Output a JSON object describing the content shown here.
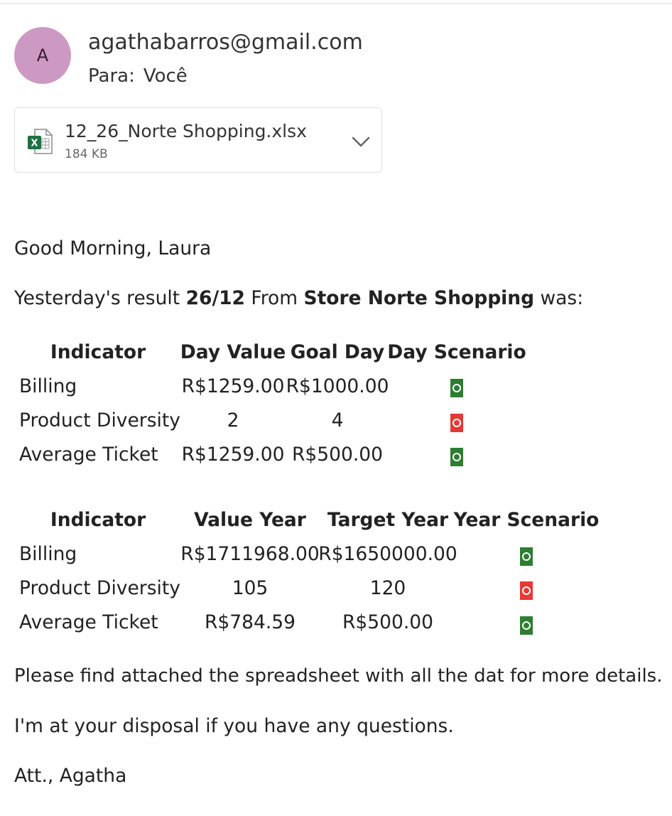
{
  "sender": {
    "initial": "A",
    "email": "agathabarros@gmail.com",
    "to_label": "Para:",
    "to_value": "Você"
  },
  "attachment": {
    "name": "12_26_Norte Shopping.xlsx",
    "size": "184 KB",
    "icon": "excel-file-icon",
    "toggle_icon": "chevron-down-icon"
  },
  "greeting": "Good Morning, Laura",
  "intro": {
    "p1": "Yesterday's result ",
    "date": "26/12",
    "p2": " From ",
    "store": "Store Norte Shopping",
    "p3": " was:"
  },
  "day_table": {
    "headers": [
      "Indicator",
      "Day Value",
      "Goal Day",
      "Day Scenario"
    ],
    "rows": [
      {
        "indicator": "Billing",
        "value": "R$1259.00",
        "goal": "R$1000.00",
        "status": "good"
      },
      {
        "indicator": "Product Diversity",
        "value": "2",
        "goal": "4",
        "status": "bad"
      },
      {
        "indicator": "Average Ticket",
        "value": "R$1259.00",
        "goal": "R$500.00",
        "status": "good"
      }
    ]
  },
  "year_table": {
    "headers": [
      "Indicator",
      "Value Year",
      "Target Year",
      "Year Scenario"
    ],
    "rows": [
      {
        "indicator": "Billing",
        "value": "R$1711968.00",
        "goal": "R$1650000.00",
        "status": "good"
      },
      {
        "indicator": "Product Diversity",
        "value": "105",
        "goal": "120",
        "status": "bad"
      },
      {
        "indicator": "Average Ticket",
        "value": "R$784.59",
        "goal": "R$500.00",
        "status": "good"
      }
    ]
  },
  "para1": "Please find attached the spreadsheet with all the dat for more details.",
  "para2": "I'm at your disposal if you have any questions.",
  "signoff": "Att., Agatha",
  "colors": {
    "good": "#2e7d32",
    "bad": "#e53935",
    "avatar": "#cc99c2",
    "excel": "#1e7145"
  }
}
